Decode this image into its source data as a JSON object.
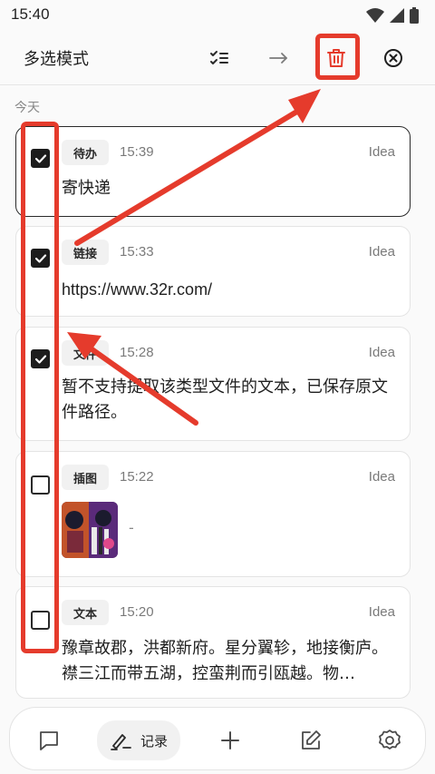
{
  "status_bar": {
    "time": "15:40"
  },
  "app_bar": {
    "title": "多选模式",
    "icons": [
      "checklist-icon",
      "arrow-right-icon",
      "trash-icon",
      "close-circle-icon"
    ]
  },
  "section": {
    "label": "今天"
  },
  "notes": [
    {
      "tag": "待办",
      "time": "15:39",
      "source": "Idea",
      "checked": true,
      "content": "寄快递"
    },
    {
      "tag": "链接",
      "time": "15:33",
      "source": "Idea",
      "checked": true,
      "content": "https://www.32r.com/"
    },
    {
      "tag": "文件",
      "time": "15:28",
      "source": "Idea",
      "checked": true,
      "content": "暂不支持提取该类型文件的文本，已保存原文件路径。"
    },
    {
      "tag": "插图",
      "time": "15:22",
      "source": "Idea",
      "checked": false,
      "content": "-"
    },
    {
      "tag": "文本",
      "time": "15:20",
      "source": "Idea",
      "checked": false,
      "content": "豫章故郡，洪都新府。星分翼轸，地接衡庐。襟三江而带五湖，控蛮荆而引瓯越。物…"
    }
  ],
  "bottom_nav": {
    "active_label": "记录",
    "icons": [
      "chat-icon",
      "pen-icon",
      "plus-icon",
      "edit-icon",
      "settings-icon"
    ]
  },
  "colors": {
    "annotation": "#e53b2c",
    "delete": "#e53b2c",
    "text": "#1f1f1f"
  }
}
